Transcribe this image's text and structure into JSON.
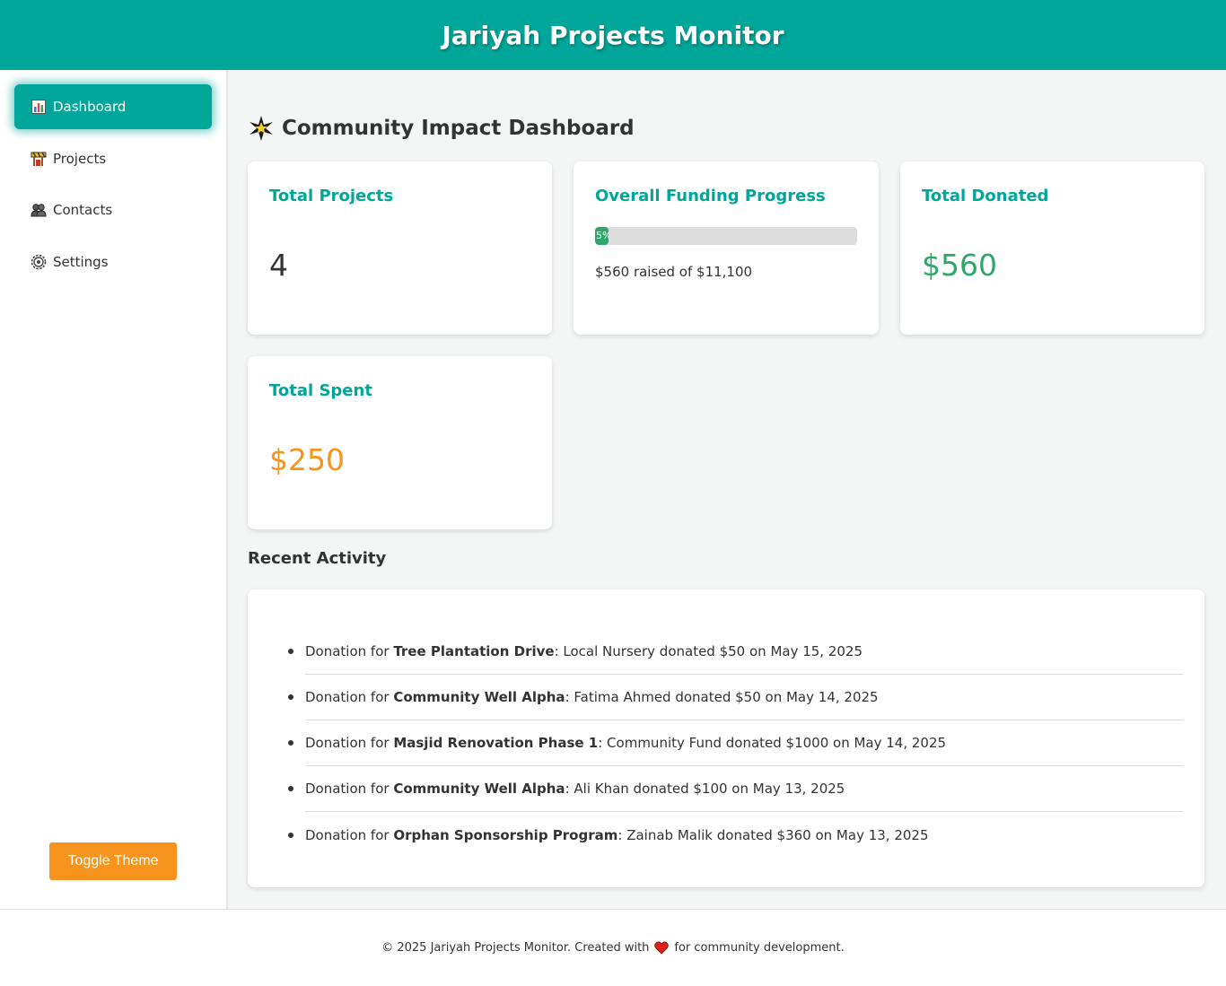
{
  "header": {
    "title": "Jariyah Projects Monitor"
  },
  "sidebar": {
    "items": [
      {
        "label": "Dashboard",
        "icon": "bar-chart-icon",
        "active": true
      },
      {
        "label": "Projects",
        "icon": "construction-icon",
        "active": false
      },
      {
        "label": "Contacts",
        "icon": "people-icon",
        "active": false
      },
      {
        "label": "Settings",
        "icon": "gear-icon",
        "active": false
      }
    ],
    "toggle_label": "Toggle Theme"
  },
  "main": {
    "title": "Community Impact Dashboard",
    "cards": {
      "total_projects": {
        "title": "Total Projects",
        "value": "4"
      },
      "funding": {
        "title": "Overall Funding Progress",
        "percent_label": "5%",
        "percent": 5,
        "caption": "$560 raised of $11,100"
      },
      "total_donated": {
        "title": "Total Donated",
        "value": "$560"
      },
      "total_spent": {
        "title": "Total Spent",
        "value": "$250"
      }
    },
    "activity": {
      "title": "Recent Activity",
      "items": [
        {
          "prefix": "Donation for ",
          "project": "Tree Plantation Drive",
          "detail": ": Local Nursery donated $50 on May 15, 2025"
        },
        {
          "prefix": "Donation for ",
          "project": "Community Well Alpha",
          "detail": ": Fatima Ahmed donated $50 on May 14, 2025"
        },
        {
          "prefix": "Donation for ",
          "project": "Masjid Renovation Phase 1",
          "detail": ": Community Fund donated $1000 on May 14, 2025"
        },
        {
          "prefix": "Donation for ",
          "project": "Community Well Alpha",
          "detail": ": Ali Khan donated $100 on May 13, 2025"
        },
        {
          "prefix": "Donation for ",
          "project": "Orphan Sponsorship Program",
          "detail": ": Zainab Malik donated $360 on May 13, 2025"
        }
      ]
    }
  },
  "footer": {
    "before": "© 2025 Jariyah Projects Monitor. Created with",
    "after": "for community development."
  },
  "colors": {
    "primary": "#00a69a",
    "accent": "#f7941d",
    "success": "#2ea86a",
    "heart": "#e0201b"
  }
}
